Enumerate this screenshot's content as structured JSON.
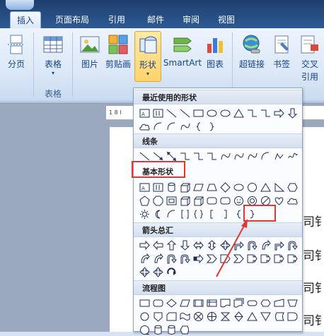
{
  "tabs": [
    "插入",
    "页面布局",
    "引用",
    "邮件",
    "审阅",
    "视图"
  ],
  "ribbon": {
    "buttons": [
      {
        "id": "page-break",
        "label": "分页",
        "icon": "page-break-icon"
      },
      {
        "id": "table",
        "label": "表格",
        "icon": "table-icon",
        "caret": "▾"
      },
      {
        "id": "picture",
        "label": "图片",
        "icon": "picture-icon"
      },
      {
        "id": "clipart",
        "label": "剪贴画",
        "icon": "clipart-icon"
      },
      {
        "id": "shapes",
        "label": "形状",
        "icon": "shapes-icon",
        "caret": "▾"
      },
      {
        "id": "smartart",
        "label": "SmartArt",
        "icon": "smartart-icon"
      },
      {
        "id": "chart",
        "label": "图表",
        "icon": "chart-icon"
      },
      {
        "id": "hyperlink",
        "label": "超链接",
        "icon": "hyperlink-icon"
      },
      {
        "id": "bookmark",
        "label": "书签",
        "icon": "bookmark-icon"
      },
      {
        "id": "crossref",
        "label": "交叉",
        "label2": "引用",
        "icon": "cross-reference-icon"
      }
    ],
    "group_table_label": "表格"
  },
  "ruler_text": "1 8 l",
  "doc_text": [
    "司钅",
    "司钅",
    "司钅",
    "司钅"
  ],
  "menu": {
    "sections": [
      {
        "title": "最近使用的形状"
      },
      {
        "title": "线条"
      },
      {
        "title": "基本形状"
      },
      {
        "title": "箭头总汇"
      },
      {
        "title": "流程图"
      }
    ]
  },
  "colors": {
    "highlight": "#e0382d",
    "accent": "#15428b"
  }
}
